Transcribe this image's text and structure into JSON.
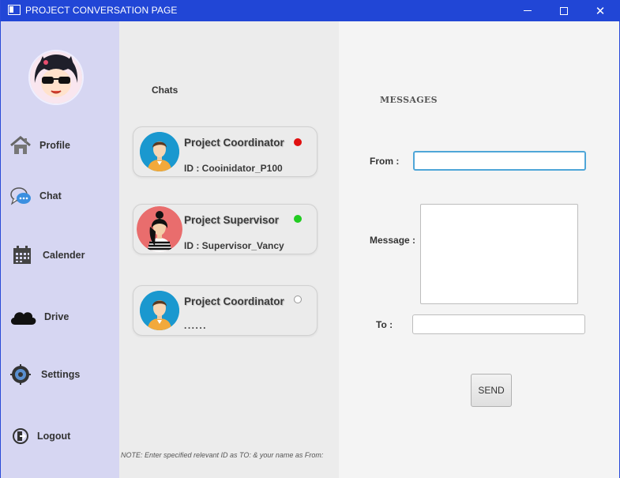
{
  "window": {
    "title": "PROJECT CONVERSATION PAGE",
    "close_glyph": "✕"
  },
  "sidebar": {
    "items": [
      {
        "label": "Profile",
        "icon": "home-icon"
      },
      {
        "label": "Chat",
        "icon": "chat-bubble-icon"
      },
      {
        "label": "Calender",
        "icon": "calendar-icon"
      },
      {
        "label": "Drive",
        "icon": "cloud-icon"
      },
      {
        "label": "Settings",
        "icon": "settings-icon"
      },
      {
        "label": "Logout",
        "icon": "logout-icon"
      }
    ]
  },
  "chats": {
    "title": "Chats",
    "items": [
      {
        "name": "Project Coordinator",
        "id_text": "ID : Cooinidator_P100",
        "status_color": "#e01010",
        "avatar": "male-avatar"
      },
      {
        "name": "Project Supervisor",
        "id_text": "ID : Supervisor_Vancy",
        "status_color": "#22cc22",
        "avatar": "female-avatar"
      },
      {
        "name": "Project Coordinator",
        "id_text": "......",
        "status_color": "#ffffff",
        "avatar": "male-avatar"
      }
    ],
    "note": "NOTE: Enter specified relevant ID as TO: & your name as From:"
  },
  "messages": {
    "title": "MESSAGES",
    "from_label": "From :",
    "message_label": "Message :",
    "to_label": "To :",
    "send_label": "SEND",
    "from_value": "",
    "message_value": "",
    "to_value": ""
  },
  "colors": {
    "titlebar": "#2146d6",
    "sidebar": "#d6d6f2",
    "focus_border": "#4fa6d8"
  }
}
